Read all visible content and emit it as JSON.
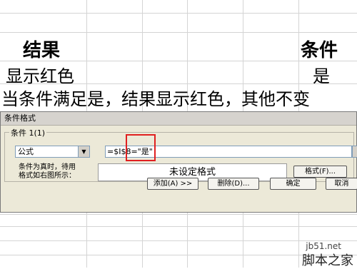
{
  "sheet": {
    "header_result": "结果",
    "header_condition": "条件",
    "cell_show_red": "显示红色",
    "cell_yes": "是",
    "note": "当条件满足是，结果显示红色，其他不变"
  },
  "dialog": {
    "title": "条件格式",
    "condition_label": "条件 1(1)",
    "type_select": "公式",
    "formula_value": "=$I$8=\"是\"",
    "hint_line1": "条件为真时，待用",
    "hint_line2": "格式如右图所示：",
    "preview_text": "未设定格式",
    "format_button": "格式(F)...",
    "add_button": "添加(A) >>",
    "delete_button": "删除(D)...",
    "ok_button": "确定",
    "cancel_button": "取消"
  },
  "watermark": {
    "site": "jb51.net",
    "name": "脚本之家"
  }
}
